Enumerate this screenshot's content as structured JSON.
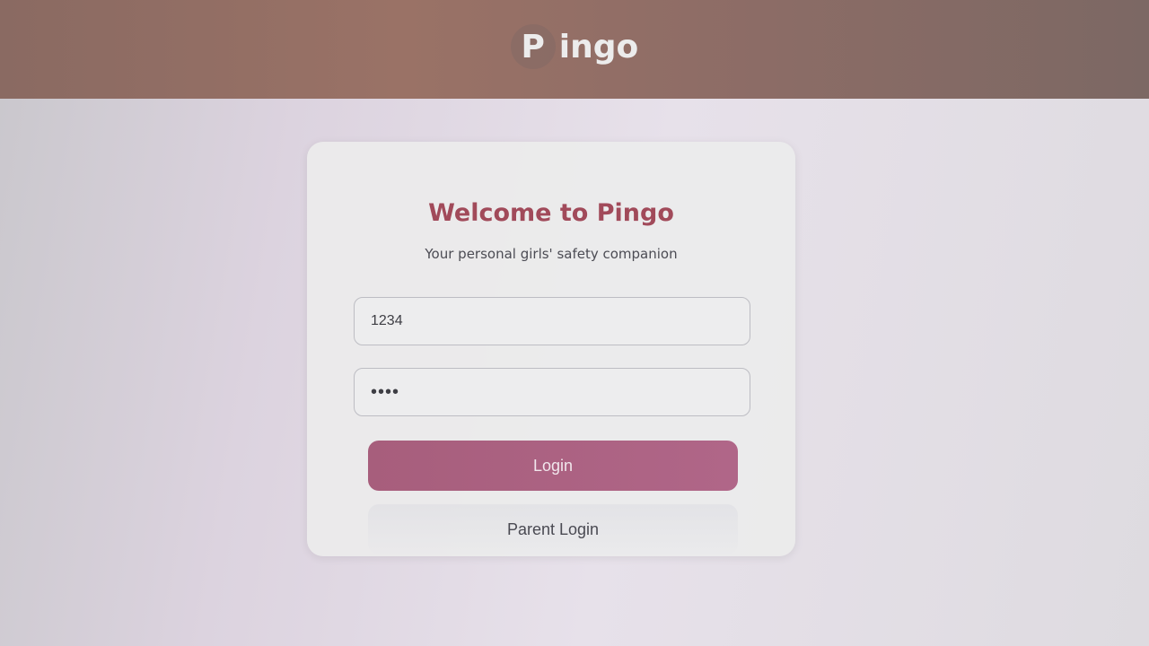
{
  "header": {
    "brand_initial": "P",
    "brand_rest": "ingo"
  },
  "login": {
    "title": "Welcome to Pingo",
    "subtitle": "Your personal girls' safety companion",
    "username_value": "1234",
    "password_value": "••••",
    "login_label": "Login",
    "parent_login_label": "Parent Login"
  },
  "colors": {
    "header": "#8f6d66",
    "title": "#a14a5a",
    "login_button": "#a75e7c"
  }
}
